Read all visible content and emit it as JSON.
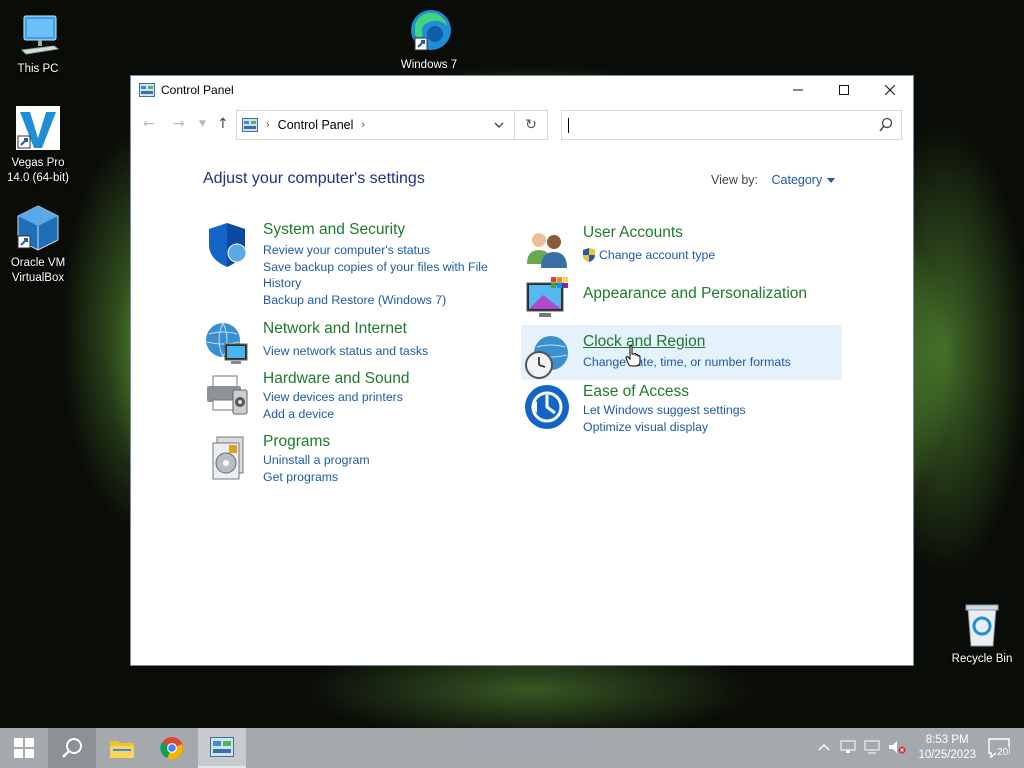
{
  "desktop": {
    "icons": [
      {
        "label": "This PC"
      },
      {
        "label": "Windows 7"
      },
      {
        "label": "Vegas Pro 14.0 (64-bit)"
      },
      {
        "label": "Oracle VM VirtualBox"
      },
      {
        "label": "Recycle Bin"
      }
    ]
  },
  "window": {
    "title": "Control Panel",
    "address": {
      "crumb": "Control Panel"
    },
    "search": {
      "placeholder": ""
    },
    "heading": "Adjust your computer's settings",
    "view_by": {
      "label": "View by:",
      "value": "Category"
    },
    "categories": [
      {
        "title": "System and Security",
        "links": [
          "Review your computer's status",
          "Save backup copies of your files with File History",
          "Backup and Restore (Windows 7)"
        ]
      },
      {
        "title": "Network and Internet",
        "links": [
          "View network status and tasks"
        ]
      },
      {
        "title": "Hardware and Sound",
        "links": [
          "View devices and printers",
          "Add a device"
        ]
      },
      {
        "title": "Programs",
        "links": [
          "Uninstall a program",
          "Get programs"
        ]
      },
      {
        "title": "User Accounts",
        "links": [
          "Change account type"
        ]
      },
      {
        "title": "Appearance and Personalization",
        "links": []
      },
      {
        "title": "Clock and Region",
        "links": [
          "Change date, time, or number formats"
        ]
      },
      {
        "title": "Ease of Access",
        "links": [
          "Let Windows suggest settings",
          "Optimize visual display"
        ]
      }
    ],
    "highlighted_category": "Clock and Region"
  },
  "taskbar": {
    "clock": {
      "time": "8:53 PM",
      "date": "10/25/2023"
    },
    "notification_count": "20"
  },
  "colors": {
    "heading": "#1e3287",
    "category_title": "#1e7a2e",
    "link": "#1e5aa8",
    "taskbar": "#a6a9ab"
  }
}
